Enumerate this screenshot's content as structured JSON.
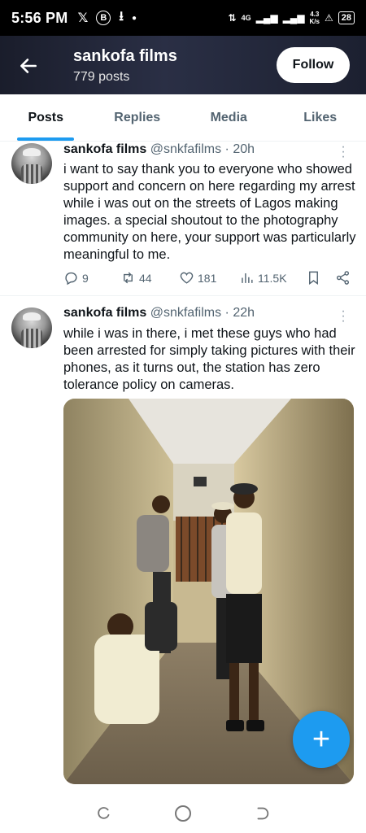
{
  "status_bar": {
    "time": "5:56 PM",
    "left_icons": [
      "x-logo-icon",
      "b-circle-icon",
      "download-icon",
      "dot-icon"
    ],
    "network": "4G",
    "speed_value": "4.3",
    "speed_unit": "K/s",
    "battery": "28"
  },
  "header": {
    "name": "sankofa films",
    "posts_count": "779 posts",
    "follow_label": "Follow"
  },
  "tabs": [
    {
      "label": "Posts",
      "active": true
    },
    {
      "label": "Replies",
      "active": false
    },
    {
      "label": "Media",
      "active": false
    },
    {
      "label": "Likes",
      "active": false
    }
  ],
  "posts": [
    {
      "name": "sankofa films",
      "handle": "@snkfafilms",
      "time": "· 20h",
      "text": "i want to say thank you to everyone who showed support and concern on here regarding my arrest while i was out on the streets of Lagos making images. a special shoutout to the photography community on here, your support was particularly meaningful to me.",
      "replies": "9",
      "reposts": "44",
      "likes": "181",
      "views": "11.5K"
    },
    {
      "name": "sankofa films",
      "handle": "@snkfafilms",
      "time": "· 22h",
      "text": "while i was in there, i met these guys who had been arrested for simply taking pictures with their phones, as it turns out, the station has zero tolerance policy on cameras."
    }
  ],
  "colors": {
    "accent": "#1d9bf0",
    "text_primary": "#0f1419",
    "text_secondary": "#536471"
  }
}
